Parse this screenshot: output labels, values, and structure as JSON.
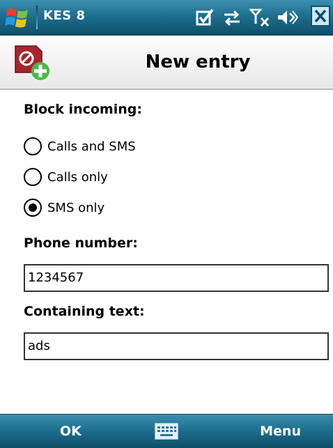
{
  "statusbar": {
    "app_title": "KES 8",
    "icons": [
      "windows-start-icon",
      "checkbox-notification-icon",
      "connectivity-icon",
      "signal-no-service-icon",
      "speaker-icon",
      "close-icon"
    ]
  },
  "header": {
    "title": "New entry",
    "icon": "block-add-icon"
  },
  "form": {
    "block_label": "Block incoming:",
    "options": [
      {
        "label": "Calls and SMS",
        "checked": false
      },
      {
        "label": "Calls only",
        "checked": false
      },
      {
        "label": "SMS only",
        "checked": true
      }
    ],
    "phone_label": "Phone number:",
    "phone_value": "1234567",
    "text_label": "Containing text:",
    "text_value": "ads"
  },
  "softkeys": {
    "left": "OK",
    "center_icon": "keyboard-icon",
    "right": "Menu"
  },
  "colors": {
    "bar_top": "#3b8fb0",
    "bar_bottom": "#0e4f69",
    "text_on_bar": "#ffffff"
  }
}
